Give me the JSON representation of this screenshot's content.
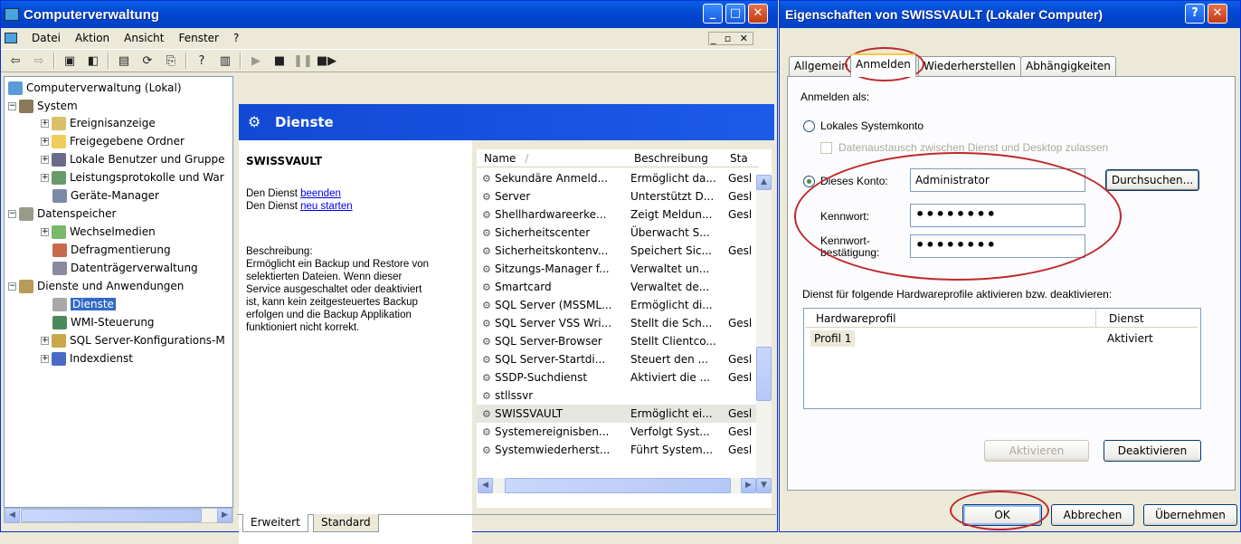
{
  "mmc": {
    "title": "Computerverwaltung",
    "menu": [
      "Datei",
      "Aktion",
      "Ansicht",
      "Fenster",
      "?"
    ],
    "mdi_buttons": "_ ▫ ✕"
  },
  "tree": {
    "items": [
      {
        "label": "Computerverwaltung (Lokal)",
        "lvl": 0
      },
      {
        "label": "System",
        "lvl": 1
      },
      {
        "label": "Ereignisanzeige",
        "lvl": 2
      },
      {
        "label": "Freigegebene Ordner",
        "lvl": 2
      },
      {
        "label": "Lokale Benutzer und Gruppe",
        "lvl": 2
      },
      {
        "label": "Leistungsprotokolle und War",
        "lvl": 2
      },
      {
        "label": "Geräte-Manager",
        "lvl": 2
      },
      {
        "label": "Datenspeicher",
        "lvl": 1
      },
      {
        "label": "Wechselmedien",
        "lvl": 2
      },
      {
        "label": "Defragmentierung",
        "lvl": 2
      },
      {
        "label": "Datenträgerverwaltung",
        "lvl": 2
      },
      {
        "label": "Dienste und Anwendungen",
        "lvl": 1
      },
      {
        "label": "Dienste",
        "lvl": 2
      },
      {
        "label": "WMI-Steuerung",
        "lvl": 2
      },
      {
        "label": "SQL Server-Konfigurations-M",
        "lvl": 2
      },
      {
        "label": "Indexdienst",
        "lvl": 2
      }
    ]
  },
  "services_header": "Dienste",
  "detail": {
    "name": "SWISSVAULT",
    "action_prefix": "Den Dienst",
    "stop_link": "beenden",
    "restart_link": "neu starten",
    "desc_label": "Beschreibung:",
    "description_lines": [
      "Ermöglicht ein Backup und Restore von",
      "selektierten Dateien. Wenn dieser",
      "Service ausgeschaltet oder deaktiviert",
      "ist, kann kein zeitgesteuertes Backup",
      "erfolgen und die Backup Applikation",
      "funktioniert nicht korrekt."
    ]
  },
  "list": {
    "headers": [
      "Name",
      "Beschreibung",
      "Sta"
    ],
    "rows": [
      [
        "Sekundäre Anmeld...",
        "Ermöglicht da...",
        "Gesl"
      ],
      [
        "Server",
        "Unterstützt D...",
        "Gesl"
      ],
      [
        "Shellhardwareerke...",
        "Zeigt Meldun...",
        "Gesl"
      ],
      [
        "Sicherheitscenter",
        "Überwacht S...",
        ""
      ],
      [
        "Sicherheitskontenv...",
        "Speichert Sic...",
        "Gesl"
      ],
      [
        "Sitzungs-Manager f...",
        "Verwaltet un...",
        ""
      ],
      [
        "Smartcard",
        "Verwaltet de...",
        ""
      ],
      [
        "SQL Server (MSSML...",
        "Ermöglicht di...",
        ""
      ],
      [
        "SQL Server VSS Wri...",
        "Stellt die Sch...",
        "Gesl"
      ],
      [
        "SQL Server-Browser",
        "Stellt Clientco...",
        ""
      ],
      [
        "SQL Server-Startdi...",
        "Steuert den ...",
        "Gesl"
      ],
      [
        "SSDP-Suchdienst",
        "Aktiviert die ...",
        "Gesl"
      ],
      [
        "stllssvr",
        "",
        ""
      ],
      [
        "SWISSVAULT",
        "Ermöglicht ei...",
        "Gesl"
      ],
      [
        "Systemereignisben...",
        "Verfolgt Syst...",
        "Gesl"
      ],
      [
        "Systemwiederherst...",
        "Führt System...",
        "Gesl"
      ]
    ],
    "selected": 13
  },
  "bottom_tabs": [
    "Erweitert",
    "Standard"
  ],
  "dialog": {
    "title": "Eigenschaften von SWISSVAULT (Lokaler Computer)",
    "tabs": [
      "Allgemein",
      "Anmelden",
      "Wiederherstellen",
      "Abhängigkeiten"
    ],
    "logon_as": "Anmelden als:",
    "local_system": "Lokales Systemkonto",
    "allow_desktop": "Datenaustausch zwischen Dienst und Desktop zulassen",
    "this_account": "Dieses Konto:",
    "account_value": "Administrator",
    "browse": "Durchsuchen...",
    "password_label": "Kennwort:",
    "password_value": "••••••••",
    "confirm_label_1": "Kennwort-",
    "confirm_label_2": "bestätigung:",
    "confirm_value": "••••••••",
    "profiles_label": "Dienst für folgende Hardwareprofile aktivieren bzw. deaktivieren:",
    "hw_headers": [
      "Hardwareprofil",
      "Dienst"
    ],
    "hw_rows": [
      [
        "Profil 1",
        "Aktiviert"
      ]
    ],
    "enable": "Aktivieren",
    "disable": "Deaktivieren",
    "ok": "OK",
    "cancel": "Abbrechen",
    "apply": "Übernehmen",
    "help_btn": "?",
    "close_btn": "✕"
  }
}
